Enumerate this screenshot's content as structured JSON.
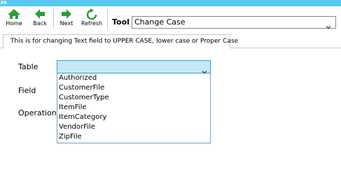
{
  "window": {
    "app_icon_text": "PR"
  },
  "toolbar": {
    "home_label": "Home",
    "back_label": "Back",
    "next_label": "Next",
    "refresh_label": "Refresh",
    "tool_label": "Tool",
    "tool_value": "Change Case"
  },
  "tab": {
    "label": "This is for changing Text field to UPPER CASE, lower case or Proper Case"
  },
  "form": {
    "table_label": "Table",
    "field_label": "Field",
    "operation_label": "Operation",
    "table_value": "",
    "table_options": [
      "Authorized",
      "CustomerFile",
      "CustomerType",
      "ItemFile",
      "ItemCategory",
      "VendorFile",
      "ZipFile"
    ]
  },
  "colors": {
    "titlebar": "#55c8ee",
    "accent_blue": "#2f9fd8",
    "select_highlight": "#c6e8f6",
    "icon_green": "#2e9e3a"
  },
  "icons": {
    "home": "home-icon",
    "back": "back-arrow-icon",
    "next": "next-arrow-icon",
    "refresh": "refresh-icon"
  }
}
